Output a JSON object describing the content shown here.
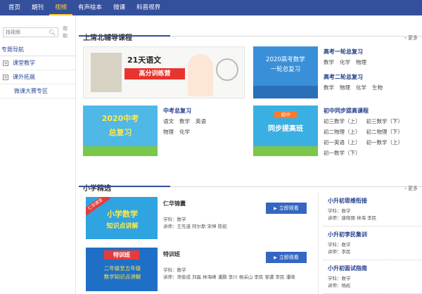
{
  "nav": {
    "tabs": [
      "首页",
      "期刊",
      "视频",
      "有声绘本",
      "微课",
      "科普视界"
    ],
    "active_index": 2
  },
  "sidebar": {
    "search_placeholder": "找视频",
    "help_label": "帮助",
    "heading": "专题导航",
    "items": [
      {
        "label": "课堂教学",
        "has_toggle": true
      },
      {
        "label": "课外拓展",
        "has_toggle": true
      },
      {
        "label": "微课大赛专区",
        "has_toggle": false
      }
    ]
  },
  "section1": {
    "title": "上清北辅导课程",
    "more": "更多",
    "courses": [
      {
        "banner": {
          "line1": "21天语文",
          "line2": "高分训练营"
        },
        "title": "",
        "tags": []
      },
      {
        "banner": {
          "line1": "2020高考数学",
          "line2": "一轮总复习"
        },
        "title": "高考一轮总复习",
        "tags": [
          "数学",
          "化学",
          "物理"
        ],
        "title2": "高考二轮总复习",
        "tags2": [
          "数学",
          "物理",
          "化学",
          "生物"
        ]
      },
      {
        "banner": {
          "line1": "2020中考",
          "line2": "总复习"
        },
        "title": "中考总复习",
        "tags": [
          "语文",
          "数学",
          "英语",
          "物理",
          "化学"
        ]
      },
      {
        "banner": {
          "line1": "初中",
          "line2": "同步提高班"
        },
        "title": "初中同步提高课程",
        "tags": [
          "初三数学（上）",
          "初三数学（下）",
          "初二物理（上）",
          "初二物理（下）",
          "初一英语（上）",
          "初一数学（上）",
          "初一数学（下）"
        ]
      }
    ]
  },
  "section2": {
    "title": "小学精选",
    "more": "更多",
    "items": [
      {
        "banner": {
          "ribbon": "仁华课堂",
          "line1": "小学数学",
          "line2": "知识点讲解"
        },
        "title": "仁华锦囊",
        "subject_label": "学科：",
        "subject": "数学",
        "teacher_label": "讲师：",
        "teachers": "王先道 阿尔斯 宋坤 陈拓",
        "button": "立即观看"
      },
      {
        "banner": {
          "ribbon": "特训班",
          "line1": "二年级至五年级",
          "line2": "数学知识点讲解"
        },
        "title": "特训班",
        "subject_label": "学科：",
        "subject": "数学",
        "teacher_label": "讲师：",
        "teachers": "须俊成 刘磊 林海峰 潘鹏 李川 杨采山 李民 邹遭 李民 潘晓",
        "button": "立即观看"
      }
    ],
    "side": [
      {
        "title": "小升初思维衔接",
        "subject": "学科：数学",
        "teacher": "讲师：唐晓丽 林海 李民"
      },
      {
        "title": "小升初李民集训",
        "subject": "学科：数学",
        "teacher": "讲师：李民"
      },
      {
        "title": "小升初面试指南",
        "subject": "学科：数学",
        "teacher": "讲师：杨彪"
      }
    ]
  },
  "colors": {
    "nav_bg": "#34509c",
    "accent": "#ffcc33",
    "link": "#1f3c8a",
    "button": "#3566c2"
  }
}
